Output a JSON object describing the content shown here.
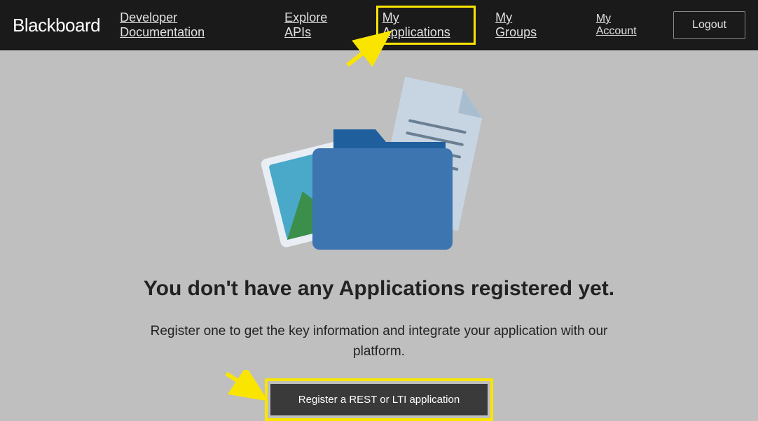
{
  "header": {
    "logo": "Blackboard",
    "nav": {
      "devDocs": "Developer Documentation",
      "exploreApis": "Explore APIs",
      "myApplications": "My Applications",
      "myGroups": "My Groups",
      "myAccount": "My Account"
    },
    "logout": "Logout"
  },
  "main": {
    "title": "You don't have any Applications registered yet.",
    "body": "Register one to get the key information and integrate your application with our platform.",
    "registerButton": "Register a REST or LTI application"
  },
  "annotations": {
    "highlightColor": "#f9e500"
  }
}
